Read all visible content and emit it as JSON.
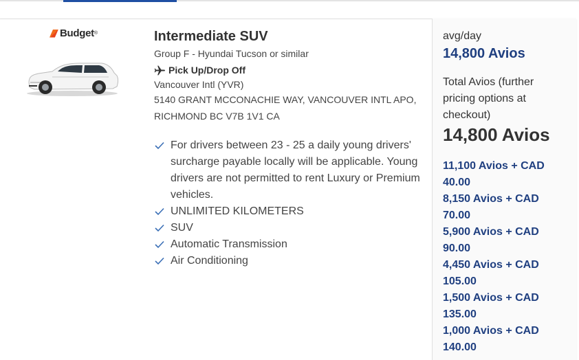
{
  "brand": {
    "name": "Budget",
    "trademark": "®",
    "logo_icon": "budget-logo-mark",
    "accent_color": "#f06a1b"
  },
  "car": {
    "title": "Intermediate SUV",
    "group": "Group F - Hyundai Tucson or similar",
    "image_icon": "white-suv-image"
  },
  "pickup": {
    "icon": "plane-icon",
    "label": "Pick Up/Drop Off",
    "location_name": "Vancouver Intl (YVR)",
    "address": "5140 GRANT MCCONACHIE WAY, VANCOUVER INTL APO, RICHMOND BC V7B 1V1 CA"
  },
  "features": [
    "For drivers between 23 - 25 a daily young drivers' surcharge payable locally will be applicable. Young drivers are not permitted to rent Luxury or Premium vehicles.",
    "UNLIMITED KILOMETERS",
    "SUV",
    "Automatic Transmission",
    "Air Conditioning"
  ],
  "pricing": {
    "avg_label": "avg/day",
    "avg_value": "14,800 Avios",
    "total_label": "Total Avios (further pricing options at checkout)",
    "total_value": "14,800 Avios",
    "options": [
      "11,100 Avios + CAD 40.00",
      "8,150 Avios + CAD 70.00",
      "5,900 Avios + CAD 90.00",
      "4,450 Avios + CAD 105.00",
      "1,500 Avios + CAD 135.00",
      "1,000 Avios + CAD 140.00"
    ]
  },
  "colors": {
    "link_blue": "#1f3f80",
    "check_blue": "#3b6fb6",
    "tab_indicator": "#1f4fa3"
  }
}
